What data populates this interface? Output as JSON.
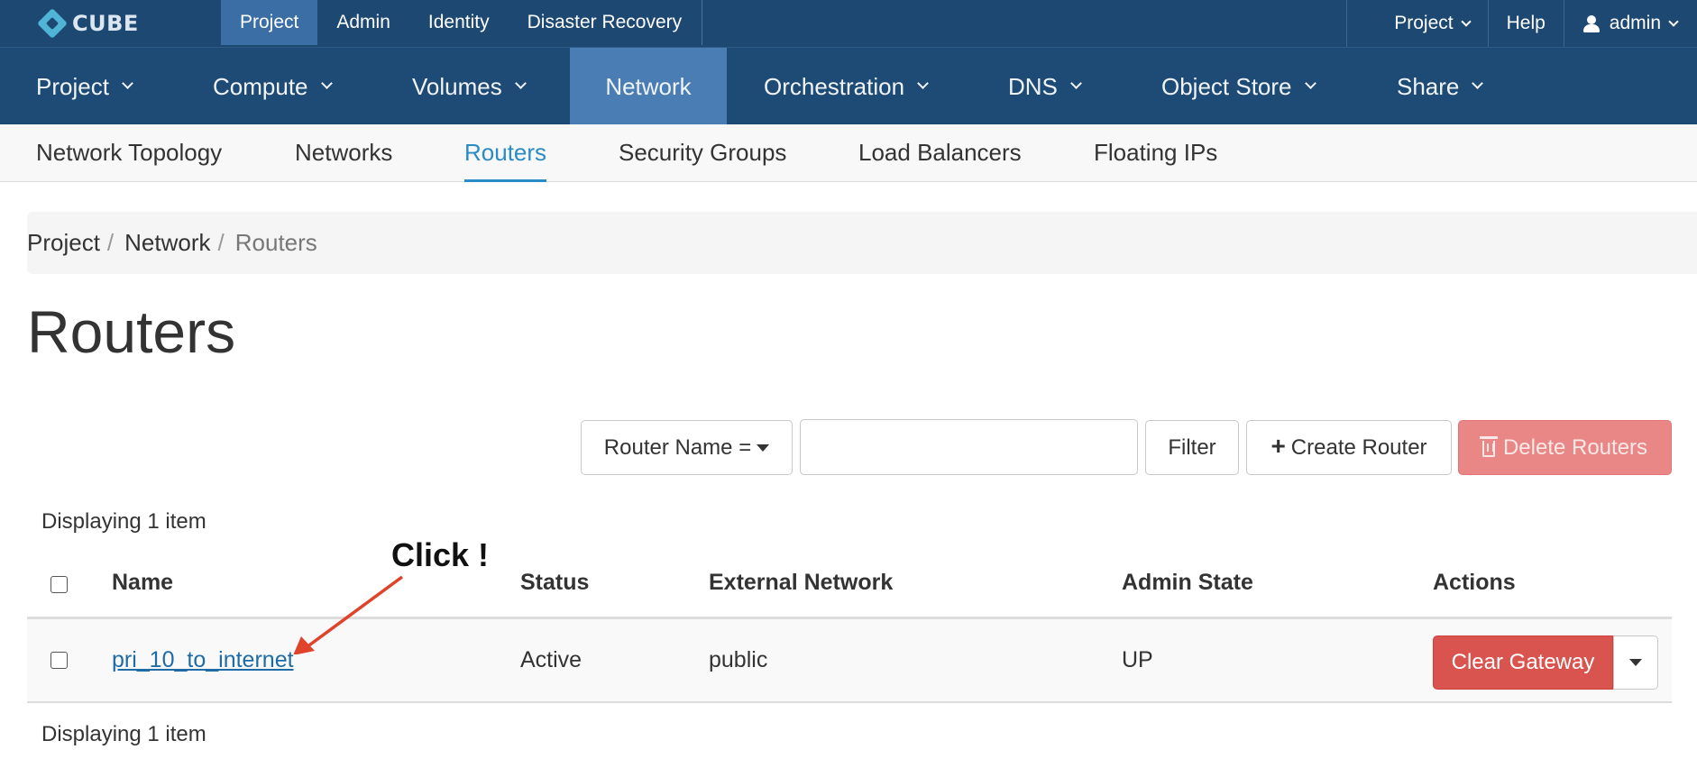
{
  "topbar": {
    "logo_text": "CUBE",
    "nav": [
      {
        "label": "Project",
        "active": true
      },
      {
        "label": "Admin",
        "active": false
      },
      {
        "label": "Identity",
        "active": false
      },
      {
        "label": "Disaster Recovery",
        "active": false
      }
    ],
    "right": {
      "project_label": "Project",
      "help_label": "Help",
      "user_label": "admin"
    }
  },
  "mainnav": {
    "items": [
      {
        "label": "Project",
        "has_dropdown": true
      },
      {
        "label": "Compute",
        "has_dropdown": true
      },
      {
        "label": "Volumes",
        "has_dropdown": true
      },
      {
        "label": "Network",
        "has_dropdown": false,
        "active": true
      },
      {
        "label": "Orchestration",
        "has_dropdown": true
      },
      {
        "label": "DNS",
        "has_dropdown": true
      },
      {
        "label": "Object Store",
        "has_dropdown": true
      },
      {
        "label": "Share",
        "has_dropdown": true
      }
    ]
  },
  "subnav": {
    "items": [
      {
        "label": "Network Topology"
      },
      {
        "label": "Networks"
      },
      {
        "label": "Routers",
        "active": true
      },
      {
        "label": "Security Groups"
      },
      {
        "label": "Load Balancers"
      },
      {
        "label": "Floating IPs"
      }
    ]
  },
  "breadcrumb": [
    "Project",
    "Network",
    "Routers"
  ],
  "page_title": "Routers",
  "toolbar": {
    "filter_field_label": "Router Name =",
    "search_value": "",
    "filter_label": "Filter",
    "create_label": "Create Router",
    "delete_label": "Delete Routers"
  },
  "table": {
    "summary_top": "Displaying 1 item",
    "summary_bottom": "Displaying 1 item",
    "columns": [
      "Name",
      "Status",
      "External Network",
      "Admin State",
      "Actions"
    ],
    "rows": [
      {
        "name": "pri_10_to_internet",
        "status": "Active",
        "external_network": "public",
        "admin_state": "UP",
        "action_label": "Clear Gateway"
      }
    ]
  },
  "annotation": {
    "text": "Click !",
    "color": "#e0432b"
  },
  "colors": {
    "topbar": "#1d4872",
    "nav_active": "#4a7db3",
    "link": "#1f6ba6",
    "subnav_active": "#2a8cc4",
    "danger": "#d9534f"
  }
}
